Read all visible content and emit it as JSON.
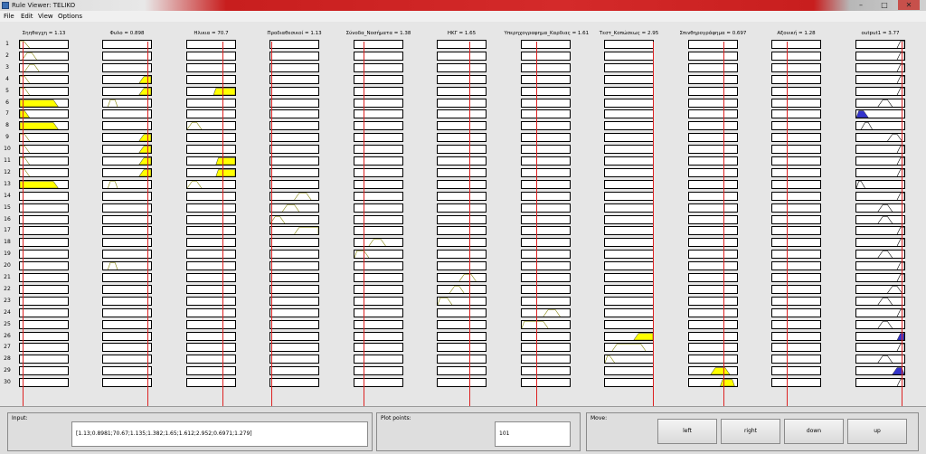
{
  "window": {
    "title": "Rule Viewer: TELIKO",
    "minimize_glyph": "–",
    "maximize_glyph": "□",
    "close_glyph": "✕"
  },
  "menu": [
    "File",
    "Edit",
    "View",
    "Options"
  ],
  "colors": {
    "input_fill": "#ffff00",
    "output_fill": "#3333cc",
    "marker": "#dd2222",
    "curve": "#808000"
  },
  "rows": [
    "1",
    "2",
    "3",
    "4",
    "5",
    "6",
    "7",
    "8",
    "9",
    "10",
    "11",
    "12",
    "13",
    "14",
    "15",
    "16",
    "17",
    "18",
    "19",
    "20",
    "21",
    "22",
    "23",
    "24",
    "25",
    "26",
    "27",
    "28",
    "29",
    "30"
  ],
  "variables": [
    {
      "title": "Σηηθαγχη = 1.13",
      "marker": 0.07,
      "rules": {
        "1": {
          "s": [
            0,
            0,
            0.08,
            0.2
          ]
        },
        "2": {
          "s": [
            0.05,
            0.15,
            0.25,
            0.35
          ]
        },
        "3": {
          "s": [
            0.1,
            0.2,
            0.3,
            0.4
          ]
        },
        "4": {
          "s": [
            0,
            0,
            0.1,
            0.2
          ]
        },
        "5": {
          "s": [
            0,
            0,
            0.1,
            0.2
          ]
        },
        "6": {
          "s": [
            0,
            0,
            0.7,
            0.8
          ],
          "f": 1
        },
        "7": {
          "s": [
            0,
            0,
            0.1,
            0.2
          ],
          "f": 1
        },
        "8": {
          "s": [
            0,
            0,
            0.7,
            0.8
          ],
          "f": 1
        },
        "9": {
          "s": [
            0,
            0,
            0.1,
            0.2
          ]
        },
        "10": {
          "s": [
            0,
            0,
            0.1,
            0.2
          ]
        },
        "11": {
          "s": [
            0,
            0,
            0.1,
            0.2
          ]
        },
        "12": {
          "s": [
            0,
            0,
            0.1,
            0.2
          ]
        },
        "13": {
          "s": [
            0,
            0,
            0.7,
            0.8
          ],
          "f": 1
        }
      }
    },
    {
      "title": "Φυλο = 0.898",
      "marker": 0.9,
      "rules": {
        "4": {
          "s": [
            0.75,
            0.85,
            1,
            1
          ],
          "f": 1
        },
        "5": {
          "s": [
            0.75,
            0.85,
            1,
            1
          ],
          "f": 1
        },
        "6": {
          "s": [
            0.1,
            0.15,
            0.25,
            0.3
          ]
        },
        "9": {
          "s": [
            0.75,
            0.85,
            1,
            1
          ],
          "f": 1
        },
        "10": {
          "s": [
            0.75,
            0.85,
            1,
            1
          ],
          "f": 1
        },
        "11": {
          "s": [
            0.75,
            0.85,
            1,
            1
          ],
          "f": 1
        },
        "12": {
          "s": [
            0.75,
            0.85,
            1,
            1
          ],
          "f": 1
        },
        "13": {
          "s": [
            0.1,
            0.15,
            0.25,
            0.3
          ]
        },
        "20": {
          "s": [
            0.1,
            0.15,
            0.25,
            0.3
          ]
        }
      }
    },
    {
      "title": "Ηλικια = 70.7",
      "marker": 0.73,
      "rules": {
        "5": {
          "s": [
            0.55,
            0.6,
            1,
            1
          ],
          "f": 1
        },
        "8": {
          "s": [
            0,
            0.1,
            0.2,
            0.3
          ]
        },
        "11": {
          "s": [
            0.6,
            0.65,
            1,
            1
          ],
          "f": 1
        },
        "12": {
          "s": [
            0.6,
            0.65,
            1,
            1
          ],
          "f": 1
        },
        "13": {
          "s": [
            0,
            0.1,
            0.2,
            0.3
          ]
        }
      }
    },
    {
      "title": "Προδιαθεσικοί = 1.13",
      "marker": 0.04,
      "rules": {
        "14": {
          "s": [
            0.5,
            0.6,
            0.75,
            0.85
          ]
        },
        "15": {
          "s": [
            0.25,
            0.35,
            0.5,
            0.6
          ]
        },
        "16": {
          "s": [
            0,
            0.1,
            0.2,
            0.3
          ]
        },
        "17": {
          "s": [
            0.5,
            0.6,
            1,
            1
          ]
        }
      }
    },
    {
      "title": "Σύνοδα_Νοσήματα = 1.38",
      "marker": 0.2,
      "rules": {
        "18": {
          "s": [
            0.3,
            0.4,
            0.55,
            0.65
          ]
        },
        "19": {
          "s": [
            0,
            0.05,
            0.2,
            0.3
          ]
        }
      }
    },
    {
      "title": "ΗΚΓ = 1.65",
      "marker": 0.65,
      "rules": {
        "21": {
          "s": [
            0.45,
            0.55,
            0.7,
            0.8
          ]
        },
        "22": {
          "s": [
            0.25,
            0.35,
            0.45,
            0.55
          ]
        },
        "23": {
          "s": [
            0,
            0.05,
            0.2,
            0.3
          ]
        }
      }
    },
    {
      "title": "Υπερηχογραφημα_Καρδιας = 1.61",
      "marker": 0.3,
      "rules": {
        "24": {
          "s": [
            0.45,
            0.55,
            0.7,
            0.8
          ]
        },
        "25": {
          "s": [
            0,
            0.05,
            0.45,
            0.55
          ]
        }
      }
    },
    {
      "title": "Τεστ_Κοπώσεως = 2.95",
      "marker": 0.98,
      "rules": {
        "26": {
          "s": [
            0.6,
            0.7,
            1,
            1
          ],
          "f": 1
        },
        "27": {
          "s": [
            0.15,
            0.25,
            0.75,
            0.85
          ]
        },
        "28": {
          "s": [
            0,
            0.05,
            0.1,
            0.2
          ]
        }
      }
    },
    {
      "title": "Σπινθηρογράφημα = 0.697",
      "marker": 0.7,
      "rules": {
        "29": {
          "s": [
            0.45,
            0.55,
            0.75,
            0.85
          ],
          "f": 1
        },
        "30": {
          "s": [
            0.65,
            0.7,
            0.9,
            0.95
          ],
          "f": 1
        }
      }
    },
    {
      "title": "Αξονική = 1.28",
      "marker": 0.3,
      "rules": {}
    },
    {
      "title": "output1 = 3.77",
      "marker": 0.92,
      "output": true,
      "rules": {
        "1": {
          "s": [
            0.85,
            0.92,
            1,
            1
          ]
        },
        "2": {
          "s": [
            0.85,
            0.92,
            1,
            1
          ]
        },
        "3": {
          "s": [
            0.85,
            0.92,
            1,
            1
          ]
        },
        "4": {
          "s": [
            0.85,
            0.92,
            1,
            1
          ]
        },
        "5": {
          "s": [
            0.85,
            0.92,
            1,
            1
          ]
        },
        "6": {
          "s": [
            0.45,
            0.55,
            0.65,
            0.75
          ]
        },
        "7": {
          "s": [
            0,
            0.05,
            0.15,
            0.25
          ],
          "f": 1
        },
        "8": {
          "s": [
            0.1,
            0.18,
            0.25,
            0.33
          ]
        },
        "9": {
          "s": [
            0.65,
            0.75,
            0.85,
            0.95
          ]
        },
        "10": {
          "s": [
            0.85,
            0.92,
            1,
            1
          ]
        },
        "11": {
          "s": [
            0.85,
            0.92,
            1,
            1
          ]
        },
        "12": {
          "s": [
            0.85,
            0.92,
            1,
            1
          ]
        },
        "13": {
          "s": [
            0,
            0.05,
            0.1,
            0.18
          ]
        },
        "14": {
          "s": [
            0.85,
            0.92,
            1,
            1
          ]
        },
        "15": {
          "s": [
            0.45,
            0.55,
            0.65,
            0.75
          ]
        },
        "16": {
          "s": [
            0.45,
            0.55,
            0.65,
            0.75
          ]
        },
        "17": {
          "s": [
            0.85,
            0.92,
            1,
            1
          ]
        },
        "18": {
          "s": [
            0.85,
            0.92,
            1,
            1
          ]
        },
        "19": {
          "s": [
            0.45,
            0.55,
            0.65,
            0.75
          ]
        },
        "20": {
          "s": [
            0.85,
            0.92,
            1,
            1
          ]
        },
        "21": {
          "s": [
            0.85,
            0.92,
            1,
            1
          ]
        },
        "22": {
          "s": [
            0.65,
            0.75,
            0.85,
            0.95
          ]
        },
        "23": {
          "s": [
            0.45,
            0.55,
            0.65,
            0.75
          ]
        },
        "24": {
          "s": [
            0.85,
            0.92,
            1,
            1
          ]
        },
        "25": {
          "s": [
            0.45,
            0.55,
            0.65,
            0.75
          ]
        },
        "26": {
          "s": [
            0.85,
            0.92,
            1,
            1
          ],
          "f": 1
        },
        "27": {
          "s": [
            0.85,
            0.92,
            1,
            1
          ]
        },
        "28": {
          "s": [
            0.45,
            0.55,
            0.65,
            0.75
          ]
        },
        "29": {
          "s": [
            0.75,
            0.85,
            0.95,
            1
          ],
          "f": 1
        },
        "30": {
          "s": [
            0.85,
            0.92,
            1,
            1
          ]
        }
      }
    }
  ],
  "footer": {
    "input_label": "Input:",
    "input_value": "[1.13;0.8981;70.67;1.135;1.382;1.65;1.612;2.952;0.6971;1.279]",
    "plot_points_label": "Plot points:",
    "plot_points_value": "101",
    "move_label": "Move:",
    "buttons": [
      "left",
      "right",
      "down",
      "up"
    ]
  }
}
